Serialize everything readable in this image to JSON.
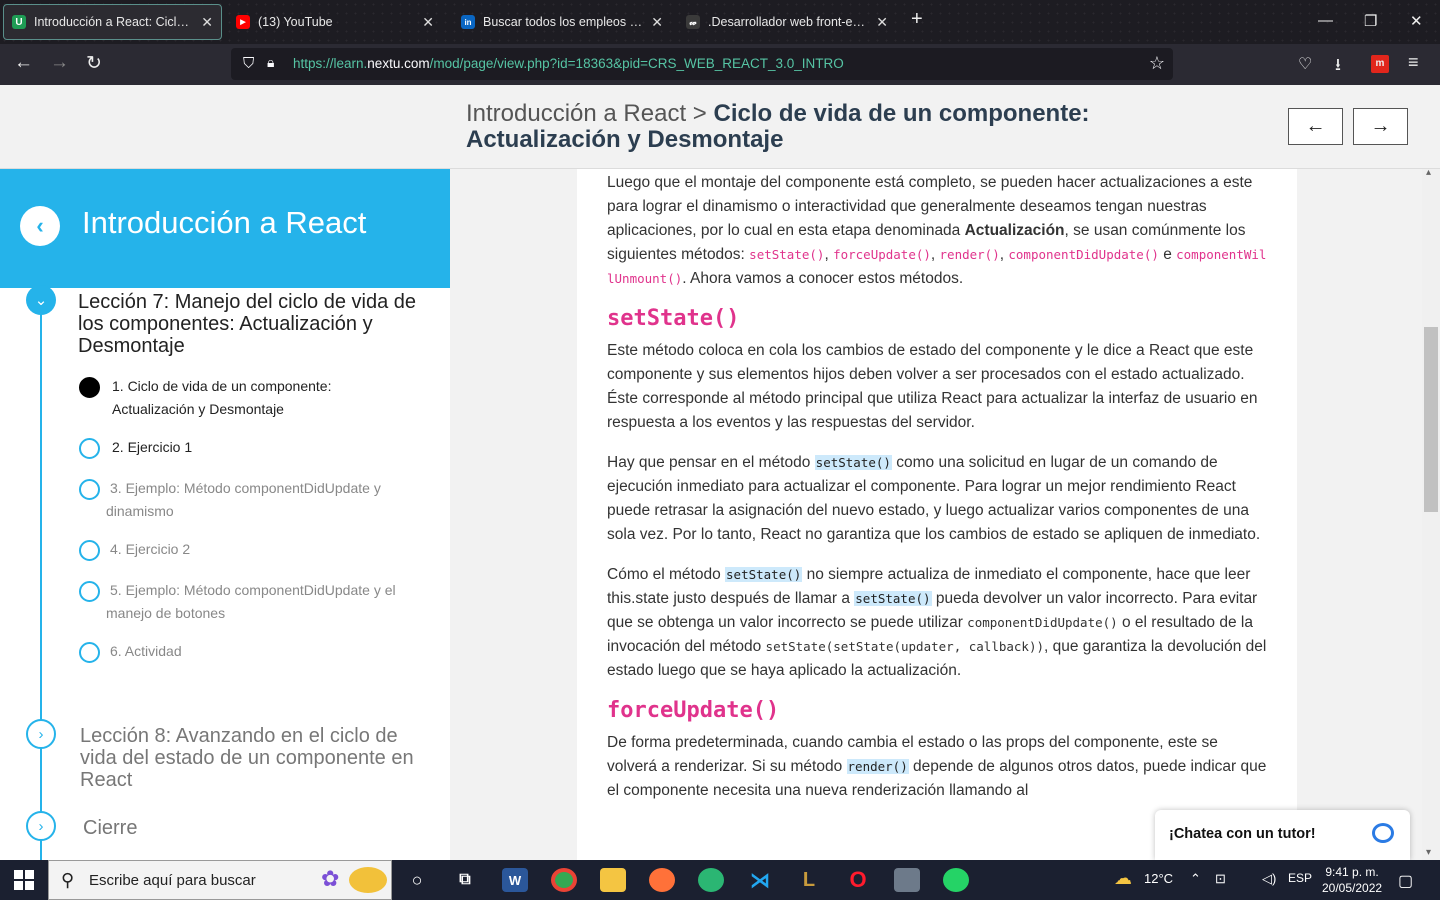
{
  "browser": {
    "tabs": [
      {
        "title": "Introducción a React: Ciclo de vida",
        "fav": "U",
        "favcolor": "#1f9d55"
      },
      {
        "title": "(13) YouTube",
        "fav": "▶",
        "favcolor": "#ff0000"
      },
      {
        "title": "Buscar todos los empleos | LinkedIn",
        "fav": "in",
        "favcolor": "#0a66c2"
      },
      {
        "title": ".Desarrollador web front-end - P",
        "fav": "𝓌",
        "favcolor": "#3a3a3a"
      }
    ],
    "new_tab": "+",
    "url_host": "https://learn.",
    "url_domain": "nextu.com",
    "url_path": "/mod/page/view.php?id=18363&pid=CRS_WEB_REACT_3.0_INTRO"
  },
  "header": {
    "course": "Introducción a React",
    "sep": ">",
    "current": "Ciclo de vida de un componente: Actualización y Desmontaje",
    "prev": "←",
    "next": "→"
  },
  "sidebar": {
    "title": "Introducción a React",
    "lesson7": "Lección 7: Manejo del ciclo de vida de los componentes: Actualización y Desmontaje",
    "subs": [
      "1. Ciclo de vida de un componente: Actualización y Desmontaje",
      "2. Ejercicio 1",
      "3. Ejemplo: Método componentDidUpdate y dinamismo",
      "4. Ejercicio 2",
      "5. Ejemplo: Método componentDidUpdate y el manejo de botones",
      "6. Actividad"
    ],
    "lesson8": "Lección 8: Avanzando en el ciclo de vida del estado de un componente en React",
    "closing": "Cierre"
  },
  "article": {
    "p1a": "Luego que el montaje del componente está completo, se pueden hacer actualizaciones a este para lograr el dinamismo o interactividad que generalmente deseamos tengan nuestras aplicaciones, por lo cual en esta etapa denominada ",
    "p1b": "Actualización",
    "p1c": ", se usan comúnmente los siguientes métodos: ",
    "m1": "setState()",
    "m2": "forceUpdate()",
    "m3": "render()",
    "m4": "componentDidUpdate()",
    "and": " e ",
    "m5": "componentWillUnmount()",
    "p1d": ". Ahora vamos a conocer estos métodos.",
    "h1": "setState()",
    "p2": "Este método coloca en cola los cambios de estado del componente y le dice a React que este componente y sus elementos hijos deben volver a ser procesados con el estado actualizado. Éste corresponde al método principal que utiliza React para actualizar la interfaz de usuario en respuesta a los eventos y las respuestas del servidor.",
    "p3a": "Hay que pensar en el método ",
    "p3b": "setState()",
    "p3c": " como una solicitud en lugar de un comando de ejecución inmediato para actualizar el componente. Para lograr un mejor rendimiento React puede retrasar la asignación del nuevo estado, y luego actualizar varios componentes de una sola vez. Por lo tanto, React no garantiza que los cambios de estado se apliquen de inmediato.",
    "p4a": "Cómo el método ",
    "p4b": "setState()",
    "p4c": " no siempre actualiza de inmediato el componente, hace que leer this.state justo después de llamar a ",
    "p4d": "setState()",
    "p4e": " pueda devolver un valor incorrecto. Para evitar que se obtenga un valor incorrecto se puede utilizar ",
    "p4f": "componentDidUpdate()",
    "p4g": " o el resultado de la invocación del método ",
    "p4h": "setState(setState(updater, callback))",
    "p4i": ", que garantiza la devolución del estado luego que se haya aplicado la actualización.",
    "h2": "forceUpdate()",
    "p5a": "De forma predeterminada, cuando cambia el estado o las props del componente, este se volverá a renderizar. Si su método ",
    "p5b": "render()",
    "p5c": " depende de algunos otros datos, puede indicar que el componente necesita una nueva renderización llamando al"
  },
  "chat": {
    "label": "¡Chatea con un tutor!"
  },
  "taskbar": {
    "search_placeholder": "Escribe aquí para buscar",
    "temp": "12°C",
    "lang": "ESP",
    "time": "9:41 p. m.",
    "date": "20/05/2022"
  }
}
